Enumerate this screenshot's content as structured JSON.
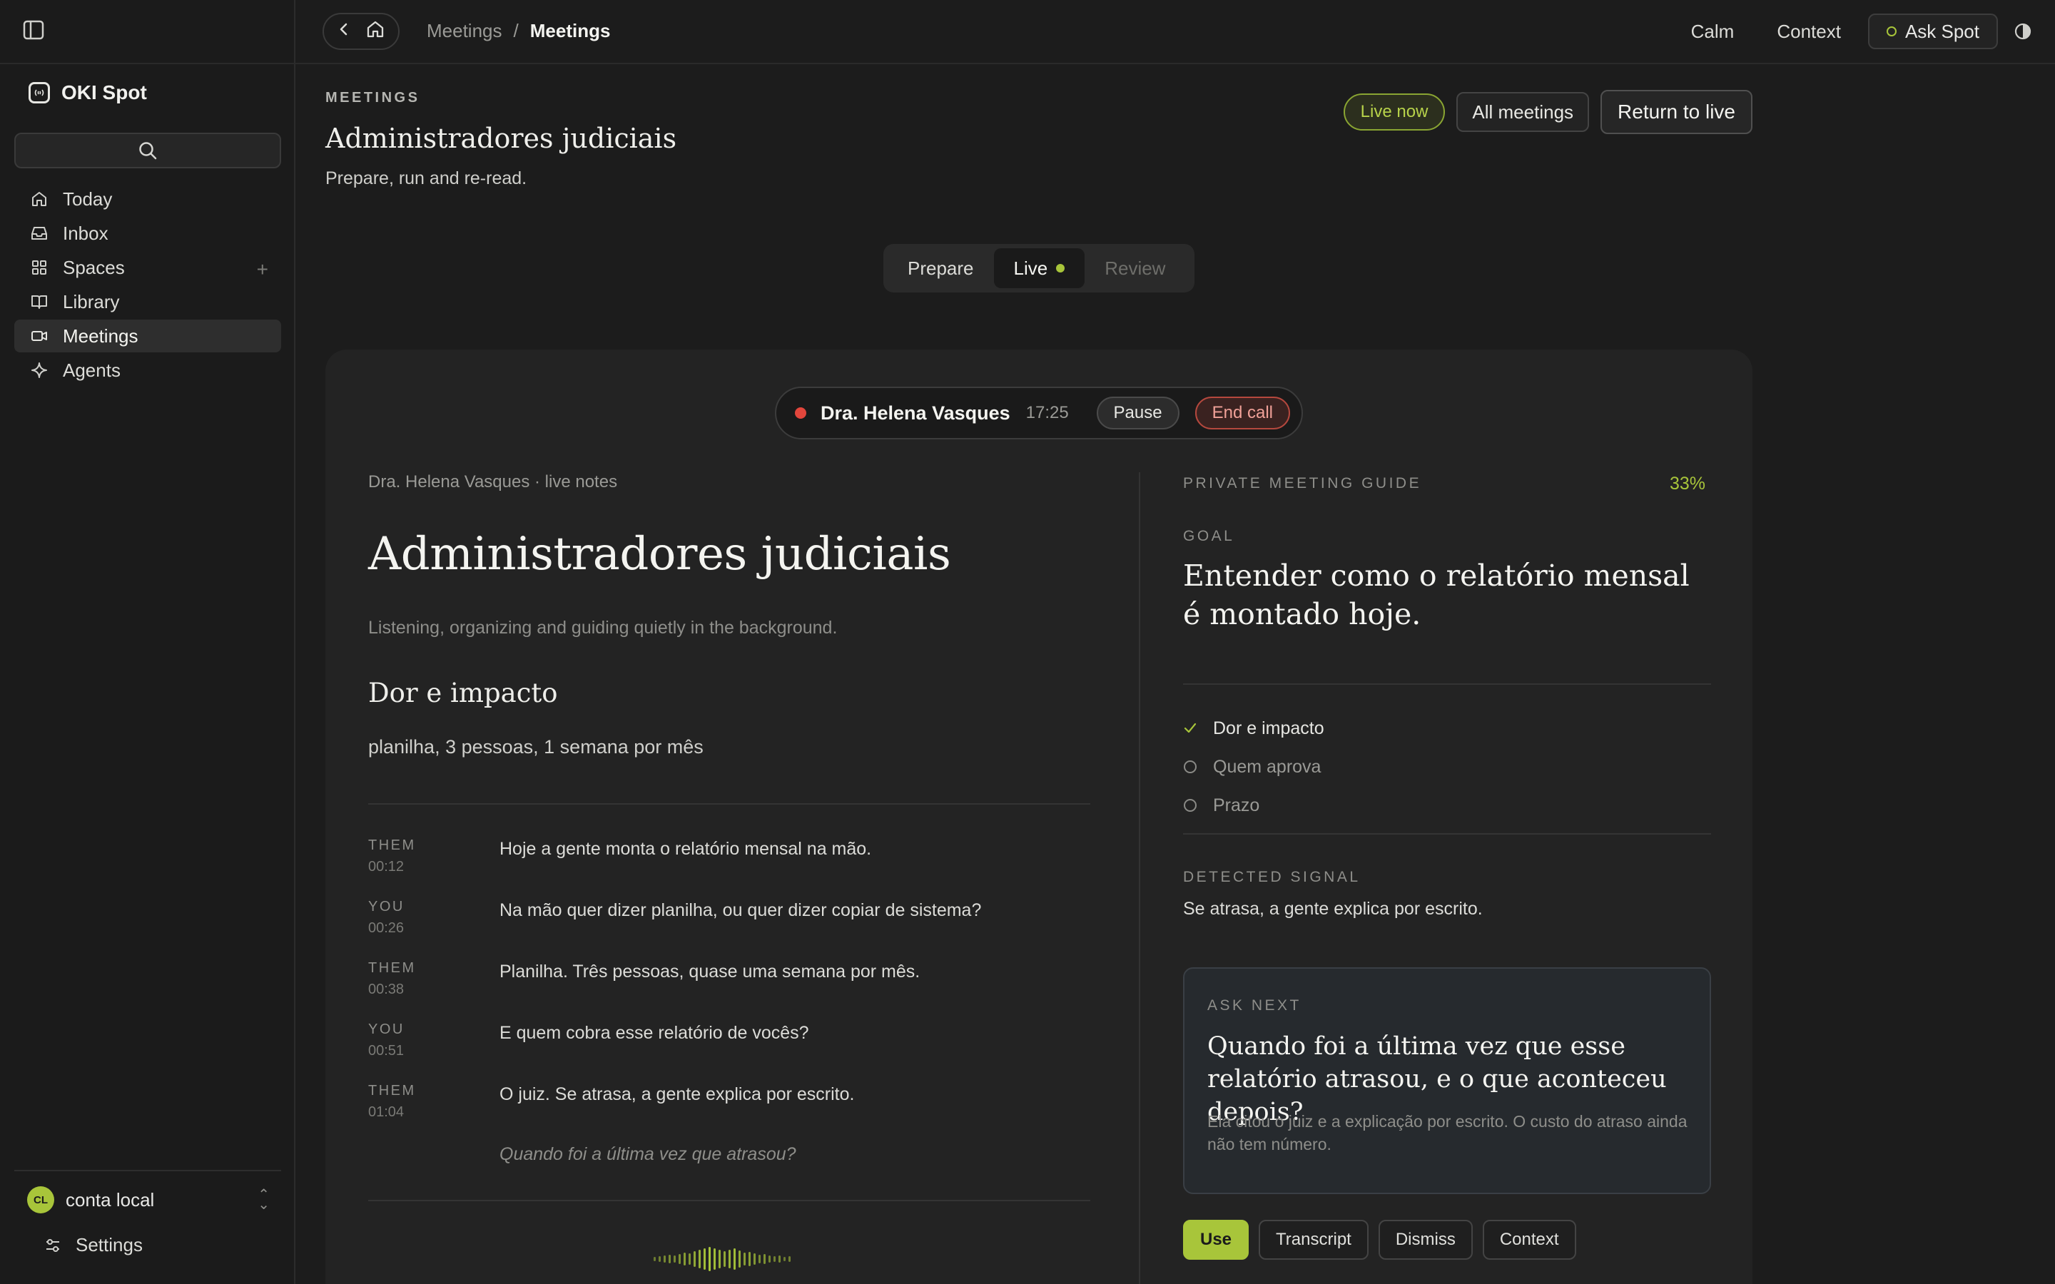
{
  "app": {
    "name": "OKI Spot"
  },
  "sidebar": {
    "items": [
      {
        "label": "Today",
        "icon": "home-icon"
      },
      {
        "label": "Inbox",
        "icon": "inbox-icon"
      },
      {
        "label": "Spaces",
        "icon": "grid-icon"
      },
      {
        "label": "Library",
        "icon": "book-icon"
      },
      {
        "label": "Meetings",
        "icon": "video-icon",
        "active": true
      },
      {
        "label": "Agents",
        "icon": "sparkle-icon"
      }
    ],
    "account": {
      "initials": "CL",
      "name": "conta local"
    },
    "settings_label": "Settings"
  },
  "topbar": {
    "breadcrumb": [
      "Meetings",
      "/",
      "Meetings"
    ],
    "links": [
      "Calm",
      "Context"
    ],
    "ask_label": "Ask Spot"
  },
  "page": {
    "eyebrow": "MEETINGS",
    "title": "Administradores judiciais",
    "subtitle": "Prepare, run and re-read.",
    "badge": "Live now",
    "all_meetings": "All meetings",
    "return_live": "Return to live"
  },
  "tabs": [
    "Prepare",
    "Live",
    "Review"
  ],
  "call": {
    "caller": "Dra. Helena Vasques",
    "timer": "17:25",
    "pause": "Pause",
    "end": "End call"
  },
  "notes": {
    "meta": "Dra. Helena Vasques · live notes",
    "title": "Administradores judiciais",
    "subtitle": "Listening, organizing and guiding quietly in the background.",
    "section": "Dor e impacto",
    "line": "planilha, 3 pessoas, 1 semana por mês"
  },
  "transcript": [
    {
      "who": "THEM",
      "time": "00:12",
      "text": "Hoje a gente monta o relatório mensal na mão."
    },
    {
      "who": "YOU",
      "time": "00:26",
      "text": "Na mão quer dizer planilha, ou quer dizer copiar de sistema?"
    },
    {
      "who": "THEM",
      "time": "00:38",
      "text": "Planilha. Três pessoas, quase uma semana por mês."
    },
    {
      "who": "YOU",
      "time": "00:51",
      "text": "E quem cobra esse relatório de vocês?"
    },
    {
      "who": "THEM",
      "time": "01:04",
      "text": "O juiz. Se atrasa, a gente explica por escrito."
    }
  ],
  "suggestion": "Quando foi a última vez que atrasou?",
  "guide": {
    "eyebrow": "PRIVATE MEETING GUIDE",
    "progress": "33%",
    "goal_eyebrow": "GOAL",
    "goal": "Entender como o relatório mensal é montado hoje.",
    "checklist": [
      {
        "label": "Dor e impacto",
        "done": true
      },
      {
        "label": "Quem aprova",
        "done": false
      },
      {
        "label": "Prazo",
        "done": false
      }
    ],
    "signal_eyebrow": "DETECTED SIGNAL",
    "signal": "Se atrasa, a gente explica por escrito.",
    "ask_eyebrow": "ASK NEXT",
    "ask_question": "Quando foi a última vez que esse relatório atrasou, e o que aconteceu depois?",
    "ask_note": "Ela citou o juiz e a explicação por escrito. O custo do atraso ainda não tem número.",
    "actions": [
      "Use",
      "Transcript",
      "Dismiss",
      "Context"
    ]
  },
  "colors": {
    "accent": "#a8c53a",
    "record": "#e2463c",
    "background": "#1c1c1c"
  }
}
